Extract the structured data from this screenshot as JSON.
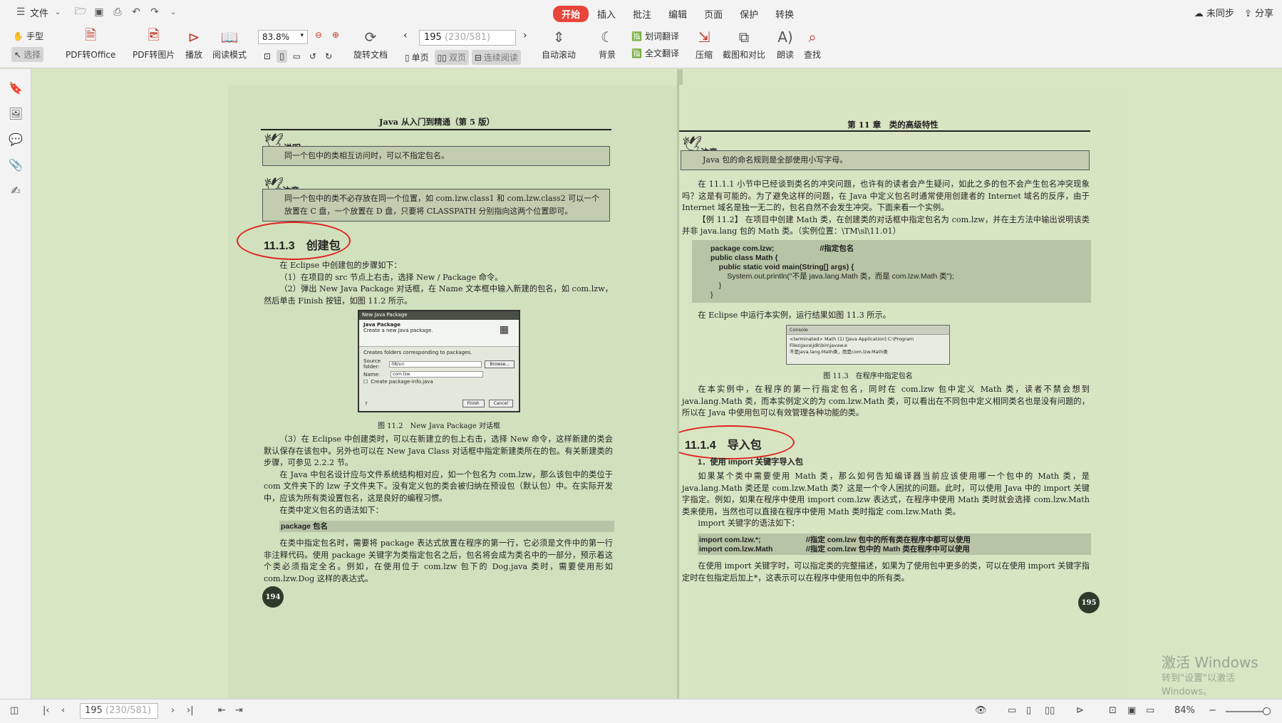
{
  "menubar": {
    "file_label": "文件",
    "tabs": [
      {
        "label": "开始",
        "active": true
      },
      {
        "label": "插入"
      },
      {
        "label": "批注"
      },
      {
        "label": "编辑"
      },
      {
        "label": "页面"
      },
      {
        "label": "保护"
      },
      {
        "label": "转换"
      }
    ],
    "sync_label": "未同步",
    "share_label": "分享"
  },
  "toolbar": {
    "hand_label": "手型",
    "select_label": "选择",
    "pdf_to_office": "PDF转Office",
    "pdf_to_image": "PDF转图片",
    "play": "播放",
    "read_mode": "阅读模式",
    "zoom_value": "83.8%",
    "rotate_doc": "旋转文档",
    "page_current": "195",
    "page_range": "(230/581)",
    "single_page": "单页",
    "double_page": "双页",
    "continuous": "连续阅读",
    "auto_scroll": "自动滚动",
    "background": "背景",
    "word_translate": "划词翻译",
    "full_translate": "全文翻译",
    "compress": "压缩",
    "screenshot_compare": "截图和对比",
    "read_aloud": "朗读",
    "find": "查找"
  },
  "left_page": {
    "running_head": "Java 从入门到精通（第 5 版）",
    "note1_tag": "说明",
    "note1_text": "同一个包中的类相互访问时，可以不指定包名。",
    "note2_tag": "注意",
    "note2_text": "同一个包中的类不必存放在同一个位置，如 com.lzw.class1 和 com.lzw.class2 可以一个放置在 C 盘，一个放置在 D 盘，只要将 CLASSPATH 分别指向这两个位置即可。",
    "section_title": "11.1.3　创建包",
    "p1": "在 Eclipse 中创建包的步骤如下：",
    "p2": "（1）在项目的 src 节点上右击，选择 New / Package 命令。",
    "p3": "（2）弹出 New Java Package 对话框，在 Name 文本框中输入新建的包名，如 com.lzw，然后单击 Finish 按钮，如图 11.2 所示。",
    "dialog": {
      "title": "New Java Package",
      "heading": "Java Package",
      "subheading": "Create a new Java package.",
      "folder_note": "Creates folders corresponding to packages.",
      "source_label": "Source folder:",
      "source_value": "08/src",
      "browse": "Browse...",
      "name_label": "Name:",
      "name_value": "com.lzw",
      "checkbox": "Create package-info.java",
      "help": "?",
      "finish": "Finish",
      "cancel": "Cancel"
    },
    "fig_caption": "图 11.2　New Java Package 对话框",
    "p4": "（3）在 Eclipse 中创建类时，可以在新建立的包上右击，选择 New 命令，这样新建的类会默认保存在该包中。另外也可以在 New Java Class 对话框中指定新建类所在的包。有关新建类的步骤，可参见 2.2.2 节。",
    "p5": "在 Java 中包名设计应与文件系统结构相对应，如一个包名为 com.lzw，那么该包中的类位于 com 文件夹下的 lzw 子文件夹下。没有定义包的类会被归纳在预设包（默认包）中。在实际开发中，应该为所有类设置包名，这是良好的编程习惯。",
    "p6": "在类中定义包名的语法如下：",
    "code": "package 包名",
    "p7": "在类中指定包名时，需要将 package 表达式放置在程序的第一行，它必须是文件中的第一行非注释代码。使用 package 关键字为类指定包名之后，包名将会成为类名中的一部分，预示着这个类必须指定全名。例如，在使用位于 com.lzw 包下的 Dog.java 类时，需要使用形如 com.lzw.Dog 这样的表达式。",
    "page_number": "194"
  },
  "right_page": {
    "running_head": "第 11 章　类的高级特性",
    "note_tag": "注意",
    "note_text": "Java 包的命名规则是全部使用小写字母。",
    "p1": "在 11.1.1 小节中已经谈到类名的冲突问题，也许有的读者会产生疑问，如此之多的包不会产生包名冲突现象吗？这是有可能的。为了避免这样的问题，在 Java 中定义包名时通常使用创建者的 Internet 域名的反序，由于 Internet 域名是独一无二的，包名自然不会发生冲突。下面来看一个实例。",
    "example": "【例 11.2】 在项目中创建 Math 类，在创建类的对话框中指定包名为 com.lzw，并在主方法中输出说明该类并非 java.lang 包的 Math 类。（实例位置：\\TM\\sl\\11.01）",
    "code_lines": [
      "package com.lzw;                      //指定包名",
      "",
      "public class Math {",
      "    public static void main(String[] args) {",
      "        System.out.println(\"不是 java.lang.Math 类，而是 com.lzw.Math 类\");",
      "    }",
      "}"
    ],
    "p2": "在 Eclipse 中运行本实例，运行结果如图 11.3 所示。",
    "console": {
      "tab": "Console",
      "line1": "<terminated> Math (1) [Java Application] C:\\Program Files\\Java\\jdk\\bin\\javaw.e",
      "line2": "不是java.lang.Math类，而是com.lzw.Math类"
    },
    "fig_caption": "图 11.3　在程序中指定包名",
    "p3": "在本实例中，在程序的第一行指定包名，同时在 com.lzw 包中定义 Math 类，读者不禁会想到 java.lang.Math 类，而本实例定义的为 com.lzw.Math 类，可以看出在不同包中定义相同类名也是没有问题的，所以在 Java 中使用包可以有效管理各种功能的类。",
    "section_title": "11.1.4　导入包",
    "sub_title": "1．使用 import 关键字导入包",
    "p4": "如果某个类中需要使用 Math 类，那么如何告知编译器当前应该使用哪一个包中的 Math 类，是 java.lang.Math 类还是 com.lzw.Math 类？这是一个令人困扰的问题。此时，可以使用 Java 中的 import 关键字指定。例如，如果在程序中使用 import com.lzw 表达式，在程序中使用 Math 类时就会选择 com.lzw.Math 类来使用，当然也可以直接在程序中使用 Math 类时指定 com.lzw.Math 类。",
    "p5": "import 关键字的语法如下：",
    "import_code": [
      {
        "code": "import com.lzw.*;",
        "comment": "//指定 com.lzw 包中的所有类在程序中都可以使用"
      },
      {
        "code": "import com.lzw.Math",
        "comment": "//指定 com.lzw 包中的 Math 类在程序中可以使用"
      }
    ],
    "p6": "在使用 import 关键字时，可以指定类的完整描述，如果为了使用包中更多的类，可以在使用 import 关键字指定时在包指定后加上*，这表示可以在程序中使用包中的所有类。",
    "page_number": "195"
  },
  "watermark": {
    "line1": "激活 Windows",
    "line2": "转到\"设置\"以激活 Windows。"
  },
  "statusbar": {
    "page_current": "195",
    "page_range": "(230/581)",
    "zoom": "84%"
  },
  "colors": {
    "accent": "#e8443a",
    "page_bg": "#d9e6c4",
    "annotation_circle": "#e02020"
  }
}
